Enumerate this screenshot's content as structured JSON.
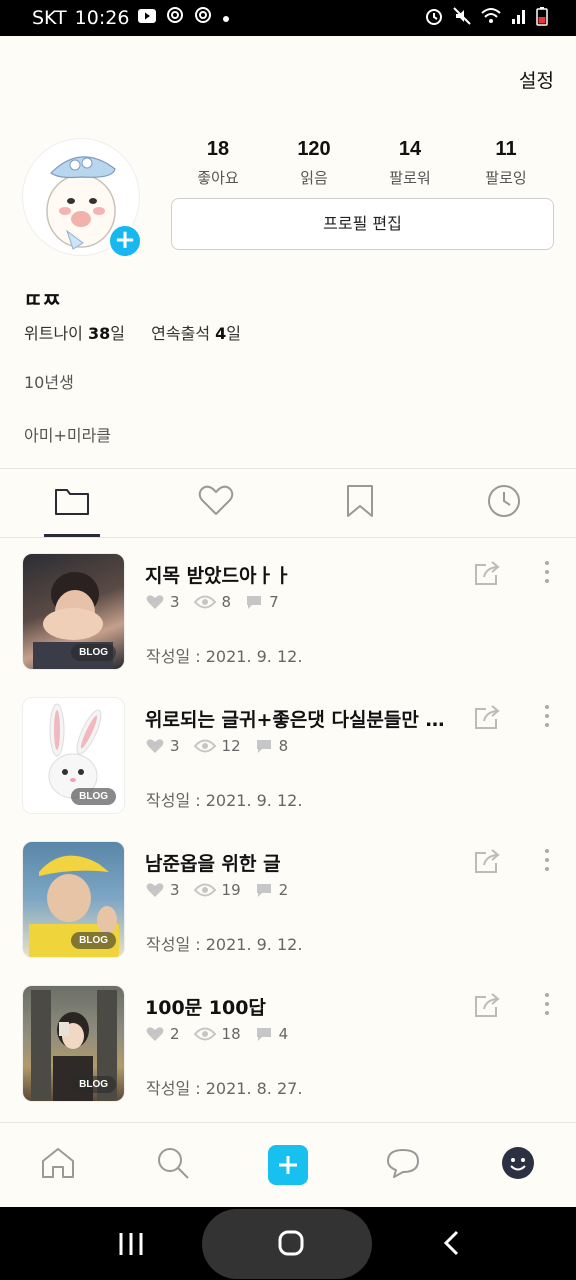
{
  "status_bar": {
    "carrier": "SKT",
    "time": "10:26"
  },
  "header": {
    "settings_label": "설정"
  },
  "profile": {
    "stats": [
      {
        "value": "18",
        "label": "좋아요"
      },
      {
        "value": "120",
        "label": "읽음"
      },
      {
        "value": "14",
        "label": "팔로워"
      },
      {
        "value": "11",
        "label": "팔로잉"
      }
    ],
    "edit_button_label": "프로필 편집",
    "username": "ㄸㅉ",
    "days_label": "위트나이",
    "days_value": "38",
    "days_unit": "일",
    "attendance_label": "연속출석",
    "attendance_value": "4",
    "attendance_unit": "일",
    "bio_line1": "10년생",
    "bio_line2": "아미+미라클"
  },
  "tabs": [
    "folder-icon",
    "heart-icon",
    "bookmark-icon",
    "clock-icon"
  ],
  "posts": [
    {
      "title": "지목 받았드아ㅏㅏ",
      "likes": "3",
      "views": "8",
      "comments": "7",
      "date": "작성일 : 2021. 9. 12.",
      "badge": "BLOG"
    },
    {
      "title": "위로되는 글귀+좋은댓 다실분들만 ...",
      "likes": "3",
      "views": "12",
      "comments": "8",
      "date": "작성일 : 2021. 9. 12.",
      "badge": "BLOG"
    },
    {
      "title": "남준옵을 위한 글",
      "likes": "3",
      "views": "19",
      "comments": "2",
      "date": "작성일 : 2021. 9. 12.",
      "badge": "BLOG"
    },
    {
      "title": "100문 100답",
      "likes": "2",
      "views": "18",
      "comments": "4",
      "date": "작성일 : 2021. 8. 27.",
      "badge": "BLOG"
    }
  ],
  "bottom_nav": [
    "home-icon",
    "search-icon",
    "add-icon",
    "chat-icon",
    "profile-icon"
  ],
  "colors": {
    "accent": "#18c0f0",
    "background": "#fdfcf7",
    "tab_indicator": "#2b2b35"
  }
}
